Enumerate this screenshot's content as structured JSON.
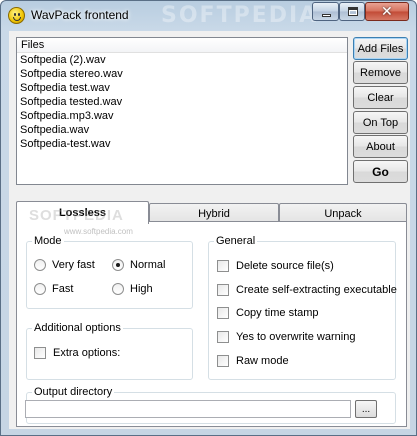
{
  "window": {
    "title": "WavPack frontend",
    "watermark": "SOFTPEDIA"
  },
  "icons": {
    "app": "smiley-icon",
    "minimize": "minimize-icon",
    "maximize": "maximize-icon",
    "close": "close-icon"
  },
  "files": {
    "header": "Files",
    "items": [
      "Softpedia (2).wav",
      "Softpedia stereo.wav",
      "Softpedia test.wav",
      "Softpedia tested.wav",
      "Softpedia.mp3.wav",
      "Softpedia.wav",
      "Softpedia-test.wav"
    ]
  },
  "buttons": {
    "add_files": "Add Files",
    "remove": "Remove",
    "clear": "Clear",
    "on_top": "On Top",
    "about": "About",
    "go": "Go"
  },
  "tabs": [
    "Lossless",
    "Hybrid",
    "Unpack"
  ],
  "tab_watermark": "SOFTPEDIA",
  "tab_watermark_url": "www.softpedia.com",
  "mode": {
    "label": "Mode",
    "options": [
      {
        "label": "Very fast",
        "selected": false
      },
      {
        "label": "Normal",
        "selected": true
      },
      {
        "label": "Fast",
        "selected": false
      },
      {
        "label": "High",
        "selected": false
      }
    ]
  },
  "additional": {
    "label": "Additional options",
    "extra_options": {
      "label": "Extra options:",
      "checked": false
    }
  },
  "general": {
    "label": "General",
    "options": [
      {
        "label": "Delete source file(s)",
        "checked": false
      },
      {
        "label": "Create self-extracting executable",
        "checked": false
      },
      {
        "label": "Copy time stamp",
        "checked": false
      },
      {
        "label": "Yes to overwrite warning",
        "checked": false
      },
      {
        "label": "Raw mode",
        "checked": false
      }
    ]
  },
  "output": {
    "label": "Output directory",
    "value": "",
    "browse_label": "..."
  }
}
